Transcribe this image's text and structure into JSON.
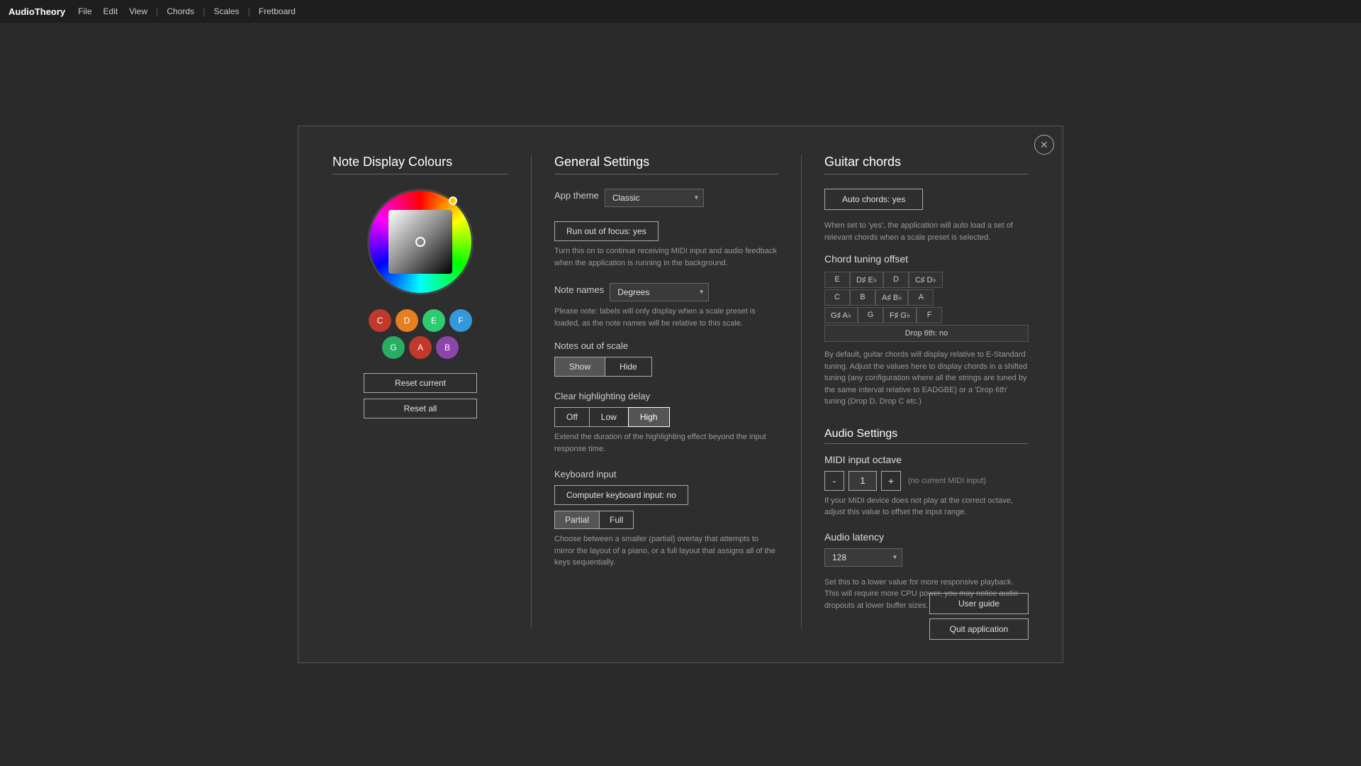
{
  "app": {
    "brand": "AudioTheory",
    "menu_items": [
      "File",
      "Edit",
      "View",
      "Chords",
      "Scales",
      "Fretboard"
    ]
  },
  "modal": {
    "close_label": "✕",
    "left": {
      "title": "Note Display Colours",
      "notes_row1": [
        "C",
        "D",
        "E",
        "F"
      ],
      "notes_row2": [
        "G",
        "A",
        "B"
      ],
      "reset_current_label": "Reset current",
      "reset_all_label": "Reset all"
    },
    "middle": {
      "title": "General Settings",
      "app_theme_label": "App theme",
      "app_theme_value": "Classic",
      "run_out_of_focus_label": "Run out of focus: yes",
      "run_out_desc": "Turn this on to continue receiving MIDI input and audio feedback when the application is running in the background.",
      "note_names_label": "Note names",
      "note_names_value": "Degrees",
      "note_names_desc": "Please note: labels will only display when a scale preset is loaded, as the note names will be relative to this scale.",
      "notes_out_label": "Notes out of scale",
      "notes_out_show": "Show",
      "notes_out_hide": "Hide",
      "clear_highlighting_label": "Clear highlighting delay",
      "highlighting_off": "Off",
      "highlighting_low": "Low",
      "highlighting_high": "High",
      "highlighting_desc": "Extend the duration of the highlighting effect beyond the input response time.",
      "keyboard_input_label": "Keyboard input",
      "keyboard_computer_label": "Computer keyboard input: no",
      "keyboard_partial": "Partial",
      "keyboard_full": "Full",
      "keyboard_desc": "Choose between a smaller (partial) overlay that attempts to mirror the layout of a piano, or a full layout that assigns all of the keys sequentially."
    },
    "right": {
      "guitar_title": "Guitar chords",
      "auto_chords_label": "Auto chords: yes",
      "auto_chords_desc": "When set to 'yes', the application will auto load a set of relevant chords when a scale preset is selected.",
      "chord_tuning_title": "Chord tuning offset",
      "chord_cells_row1": [
        "E",
        "D♯ E♭",
        "D",
        "C♯ D♭"
      ],
      "chord_cells_row2": [
        "C",
        "B",
        "A♯ B♭",
        "A"
      ],
      "chord_cells_row3": [
        "G♯ A♭",
        "G",
        "F♯ G♭",
        "F"
      ],
      "drop_6th_label": "Drop 6th: no",
      "chord_tuning_desc": "By default, guitar chords will display relative to E-Standard tuning. Adjust the values here to display chords in a shifted tuning (any configuration where all the strings are tuned by the same interval relative to EADGBE) or a 'Drop 6th' tuning (Drop D, Drop C etc.)",
      "audio_title": "Audio Settings",
      "midi_octave_title": "MIDI input octave",
      "midi_minus": "-",
      "midi_value": "1",
      "midi_plus": "+",
      "midi_note_label": "(no current MIDI input)",
      "midi_desc": "If your MIDI device does not play at the correct octave, adjust this value to offset the input range.",
      "audio_latency_title": "Audio latency",
      "latency_value": "128",
      "latency_desc": "Set this to a lower value for more responsive playback. This will require more CPU power, you may notice audio dropouts at lower buffer sizes.",
      "user_guide_label": "User guide",
      "quit_label": "Quit application"
    }
  }
}
